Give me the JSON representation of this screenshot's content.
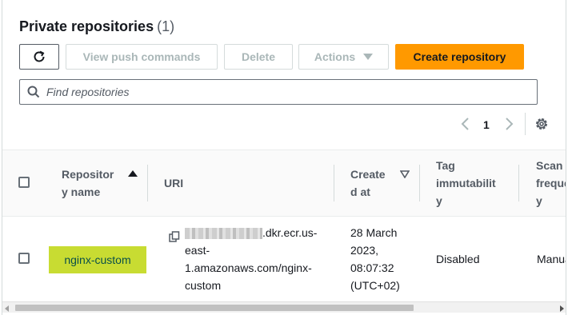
{
  "header": {
    "title": "Private repositories",
    "count": "(1)"
  },
  "toolbar": {
    "view_push_label": "View push commands",
    "delete_label": "Delete",
    "actions_label": "Actions",
    "create_label": "Create repository"
  },
  "search": {
    "placeholder": "Find repositories",
    "value": ""
  },
  "pagination": {
    "current_page": "1"
  },
  "table": {
    "columns": {
      "name_line1": "Repositor",
      "name_line2": "y name",
      "uri": "URI",
      "created_line1": "Create",
      "created_line2": "d at",
      "tag_line1": "Tag",
      "tag_line2": "immutabilit",
      "tag_line3": "y",
      "scan_line1": "Scan",
      "scan_line2": "freque",
      "scan_line3": "y"
    },
    "rows": [
      {
        "name": "nginx-custom",
        "uri_line1_suffix": ".dkr.ecr.us-",
        "uri_line2": "east-",
        "uri_line3": "1.amazonaws.com/nginx-",
        "uri_line4": "custom",
        "created_line1": "28 March",
        "created_line2": "2023,",
        "created_line3": "08:07:32",
        "created_line4": "(UTC+02)",
        "tag_immutability": "Disabled",
        "scan_frequency": "Manua"
      }
    ]
  },
  "colors": {
    "primary_button": "#ff9900",
    "row_highlight": "#c8dc32",
    "link": "#0a4f4a"
  },
  "icons": {
    "refresh": "refresh-icon",
    "search": "search-icon",
    "prev": "chevron-left-icon",
    "next": "chevron-right-icon",
    "settings": "gear-icon",
    "copy": "copy-icon",
    "sort_asc": "sort-ascending-icon",
    "sort_desc": "sort-descending-icon"
  }
}
